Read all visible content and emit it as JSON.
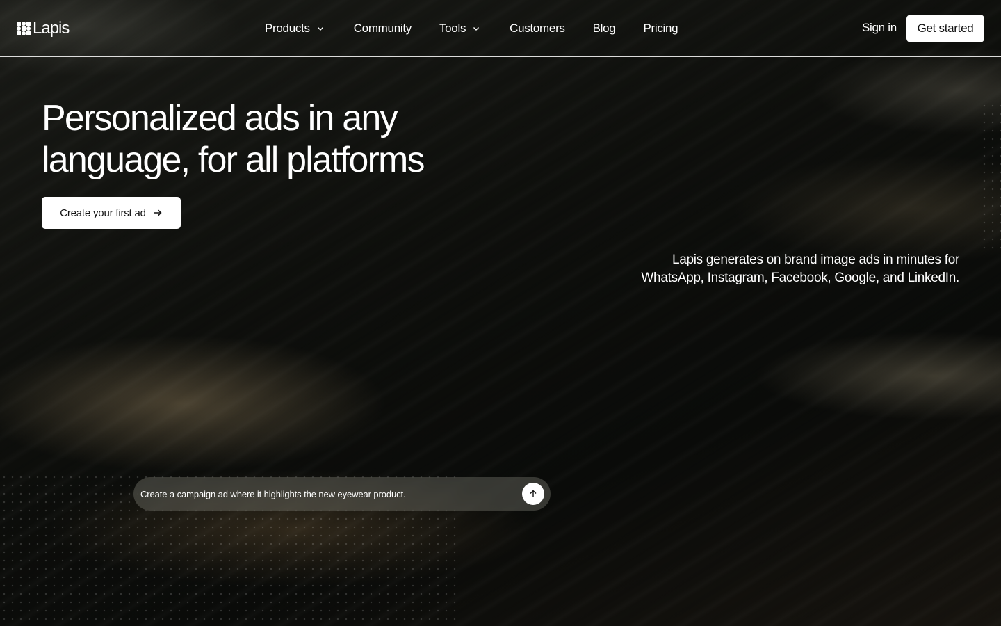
{
  "brand": {
    "name": "Lapis",
    "logo_icon": "lapis-grid-logo-icon"
  },
  "nav": {
    "items": [
      {
        "label": "Products",
        "has_dropdown": true
      },
      {
        "label": "Community",
        "has_dropdown": false
      },
      {
        "label": "Tools",
        "has_dropdown": true
      },
      {
        "label": "Customers",
        "has_dropdown": false
      },
      {
        "label": "Blog",
        "has_dropdown": false
      },
      {
        "label": "Pricing",
        "has_dropdown": false
      }
    ],
    "sign_in": "Sign in",
    "get_started": "Get started"
  },
  "hero": {
    "headline_line1": "Personalized ads in any",
    "headline_line2": "language, for all platforms",
    "cta_label": "Create your first ad",
    "cta_icon": "arrow-right-icon",
    "subtext_line1": "Lapis generates on brand image ads in minutes for",
    "subtext_line2": "WhatsApp, Instagram, Facebook, Google, and LinkedIn."
  },
  "prompt": {
    "placeholder": "Create a campaign ad where it highlights the new eyewear product.",
    "send_icon": "arrow-up-icon"
  },
  "colors": {
    "background": "#0b0c0a",
    "button_bg": "#ffffff",
    "button_text": "#111111",
    "text": "#ffffff"
  }
}
